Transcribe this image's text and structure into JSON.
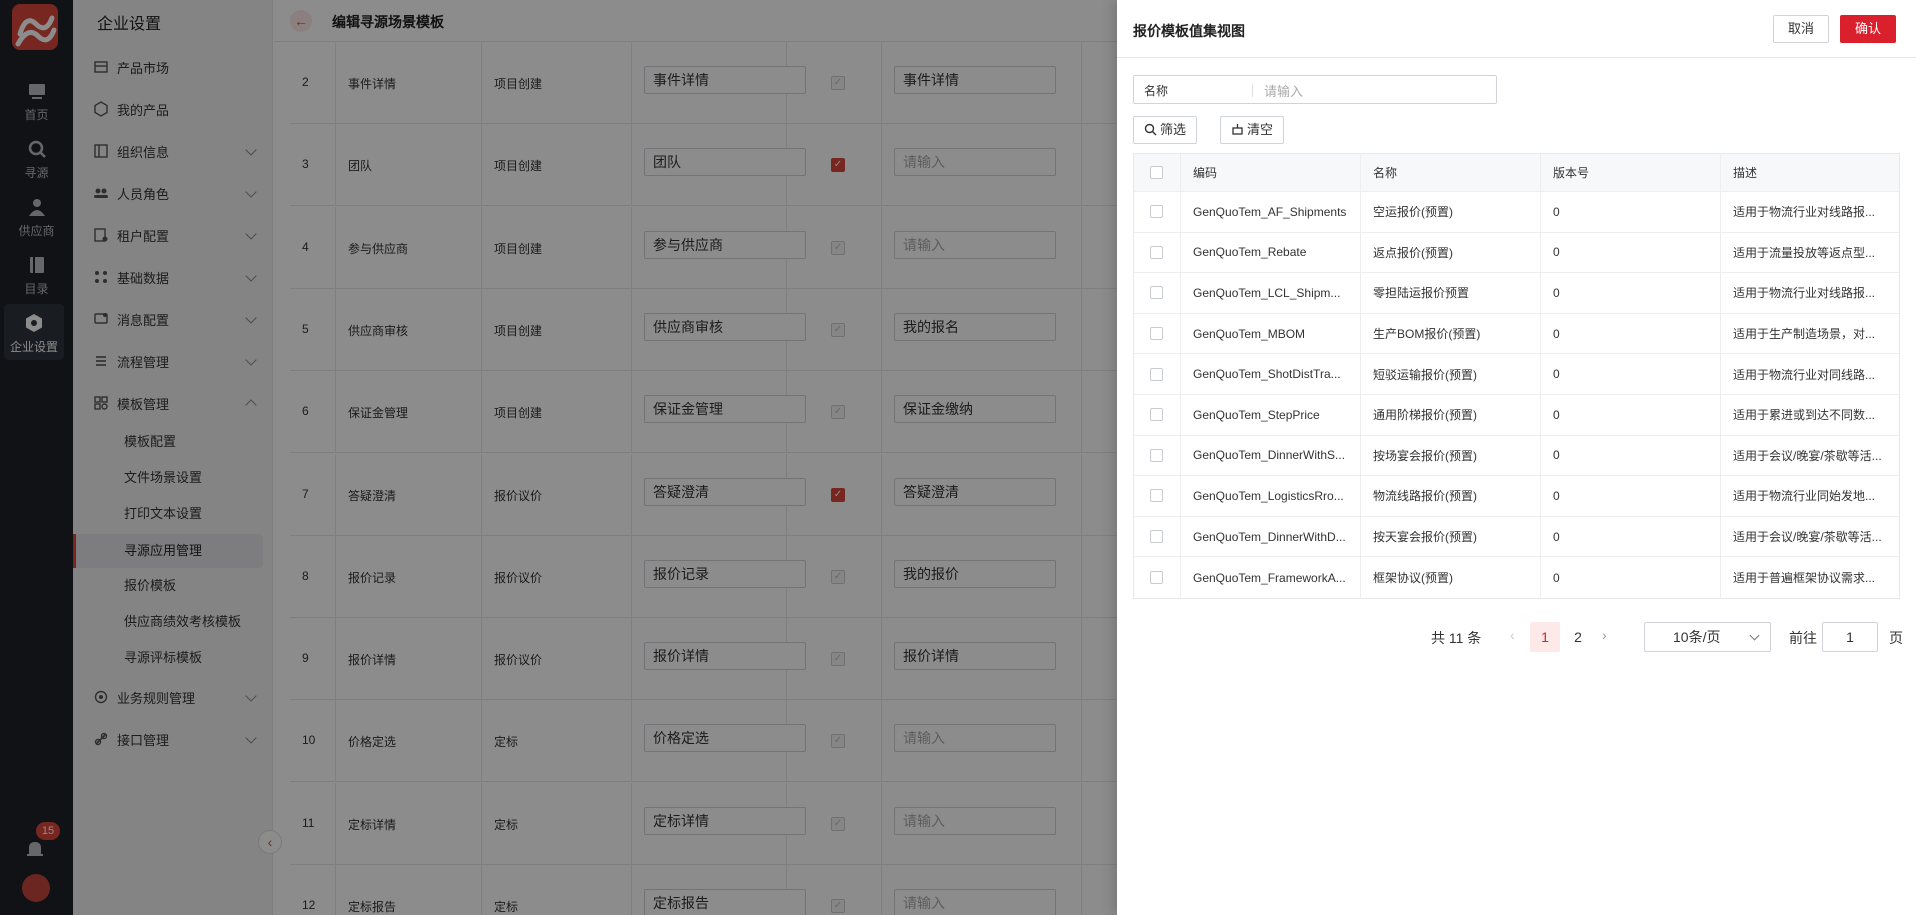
{
  "rail": {
    "items": [
      {
        "label": "首页",
        "icon": "home-icon"
      },
      {
        "label": "寻源",
        "icon": "search-source-icon"
      },
      {
        "label": "供应商",
        "icon": "supplier-icon"
      },
      {
        "label": "目录",
        "icon": "catalog-icon"
      },
      {
        "label": "企业设置",
        "icon": "settings-icon"
      }
    ],
    "notification_count": "15"
  },
  "menu": {
    "title": "企业设置",
    "items": [
      {
        "label": "产品市场",
        "icon": "store-icon"
      },
      {
        "label": "我的产品",
        "icon": "cube-icon"
      },
      {
        "label": "组织信息",
        "icon": "org-icon"
      },
      {
        "label": "人员角色",
        "icon": "users-icon"
      },
      {
        "label": "租户配置",
        "icon": "tenant-icon"
      },
      {
        "label": "基础数据",
        "icon": "data-icon"
      },
      {
        "label": "消息配置",
        "icon": "message-icon"
      },
      {
        "label": "流程管理",
        "icon": "flow-icon"
      },
      {
        "label": "模板管理",
        "icon": "template-icon"
      }
    ],
    "template_sub": [
      "模板配置",
      "文件场景设置",
      "打印文本设置",
      "寻源应用管理",
      "报价模板",
      "供应商绩效考核模板",
      "寻源评标模板"
    ],
    "bottom_items": [
      {
        "label": "业务规则管理",
        "icon": "rules-icon"
      },
      {
        "label": "接口管理",
        "icon": "api-icon"
      }
    ]
  },
  "main": {
    "title": "编辑寻源场景模板",
    "rows": [
      {
        "no": "2",
        "name": "事件详情",
        "stage": "项目创建",
        "input": "事件详情",
        "checked": false,
        "alias": "事件详情",
        "alias_ph": false
      },
      {
        "no": "3",
        "name": "团队",
        "stage": "项目创建",
        "input": "团队",
        "checked": true,
        "alias": "请输入",
        "alias_ph": true
      },
      {
        "no": "4",
        "name": "参与供应商",
        "stage": "项目创建",
        "input": "参与供应商",
        "checked": false,
        "alias": "请输入",
        "alias_ph": true
      },
      {
        "no": "5",
        "name": "供应商审核",
        "stage": "项目创建",
        "input": "供应商审核",
        "checked": false,
        "alias": "我的报名",
        "alias_ph": false
      },
      {
        "no": "6",
        "name": "保证金管理",
        "stage": "项目创建",
        "input": "保证金管理",
        "checked": false,
        "alias": "保证金缴纳",
        "alias_ph": false
      },
      {
        "no": "7",
        "name": "答疑澄清",
        "stage": "报价议价",
        "input": "答疑澄清",
        "checked": true,
        "alias": "答疑澄清",
        "alias_ph": false
      },
      {
        "no": "8",
        "name": "报价记录",
        "stage": "报价议价",
        "input": "报价记录",
        "checked": false,
        "alias": "我的报价",
        "alias_ph": false
      },
      {
        "no": "9",
        "name": "报价详情",
        "stage": "报价议价",
        "input": "报价详情",
        "checked": false,
        "alias": "报价详情",
        "alias_ph": false
      },
      {
        "no": "10",
        "name": "价格定选",
        "stage": "定标",
        "input": "价格定选",
        "checked": false,
        "alias": "请输入",
        "alias_ph": true
      },
      {
        "no": "11",
        "name": "定标详情",
        "stage": "定标",
        "input": "定标详情",
        "checked": false,
        "alias": "请输入",
        "alias_ph": true
      },
      {
        "no": "12",
        "name": "定标报告",
        "stage": "定标",
        "input": "定标报告",
        "checked": false,
        "alias": "请输入",
        "alias_ph": true
      }
    ]
  },
  "drawer": {
    "title": "报价模板值集视图",
    "cancel": "取消",
    "confirm": "确认",
    "search_label": "名称",
    "search_placeholder": "请输入",
    "filter": "筛选",
    "clear": "清空",
    "columns": [
      "编码",
      "名称",
      "版本号",
      "描述"
    ],
    "rows": [
      {
        "code": "GenQuoTem_AF_Shipments",
        "name": "空运报价(预置)",
        "version": "0",
        "desc": "适用于物流行业对线路报..."
      },
      {
        "code": "GenQuoTem_Rebate",
        "name": "返点报价(预置)",
        "version": "0",
        "desc": "适用于流量投放等返点型..."
      },
      {
        "code": "GenQuoTem_LCL_Shipm...",
        "name": "零担陆运报价预置",
        "version": "0",
        "desc": "适用于物流行业对线路报..."
      },
      {
        "code": "GenQuoTem_MBOM",
        "name": "生产BOM报价(预置)",
        "version": "0",
        "desc": "适用于生产制造场景，对..."
      },
      {
        "code": "GenQuoTem_ShotDistTra...",
        "name": "短驳运输报价(预置)",
        "version": "0",
        "desc": "适用于物流行业对同线路..."
      },
      {
        "code": "GenQuoTem_StepPrice",
        "name": "通用阶梯报价(预置)",
        "version": "0",
        "desc": "适用于累进或到达不同数..."
      },
      {
        "code": "GenQuoTem_DinnerWithS...",
        "name": "按场宴会报价(预置)",
        "version": "0",
        "desc": "适用于会议/晚宴/茶歇等活..."
      },
      {
        "code": "GenQuoTem_LogisticsRro...",
        "name": "物流线路报价(预置)",
        "version": "0",
        "desc": "适用于物流行业同始发地..."
      },
      {
        "code": "GenQuoTem_DinnerWithD...",
        "name": "按天宴会报价(预置)",
        "version": "0",
        "desc": "适用于会议/晚宴/茶歇等活..."
      },
      {
        "code": "GenQuoTem_FrameworkA...",
        "name": "框架协议(预置)",
        "version": "0",
        "desc": "适用于普遍框架协议需求..."
      }
    ],
    "pager": {
      "total": "共 11 条",
      "pages": [
        "1",
        "2"
      ],
      "page_size": "10条/页",
      "goto_prefix": "前往",
      "goto_value": "1",
      "goto_suffix": "页"
    }
  },
  "colors": {
    "brand": "#d9202c",
    "rail_bg": "#1f2229",
    "menu_bg": "#f0f1f3"
  }
}
